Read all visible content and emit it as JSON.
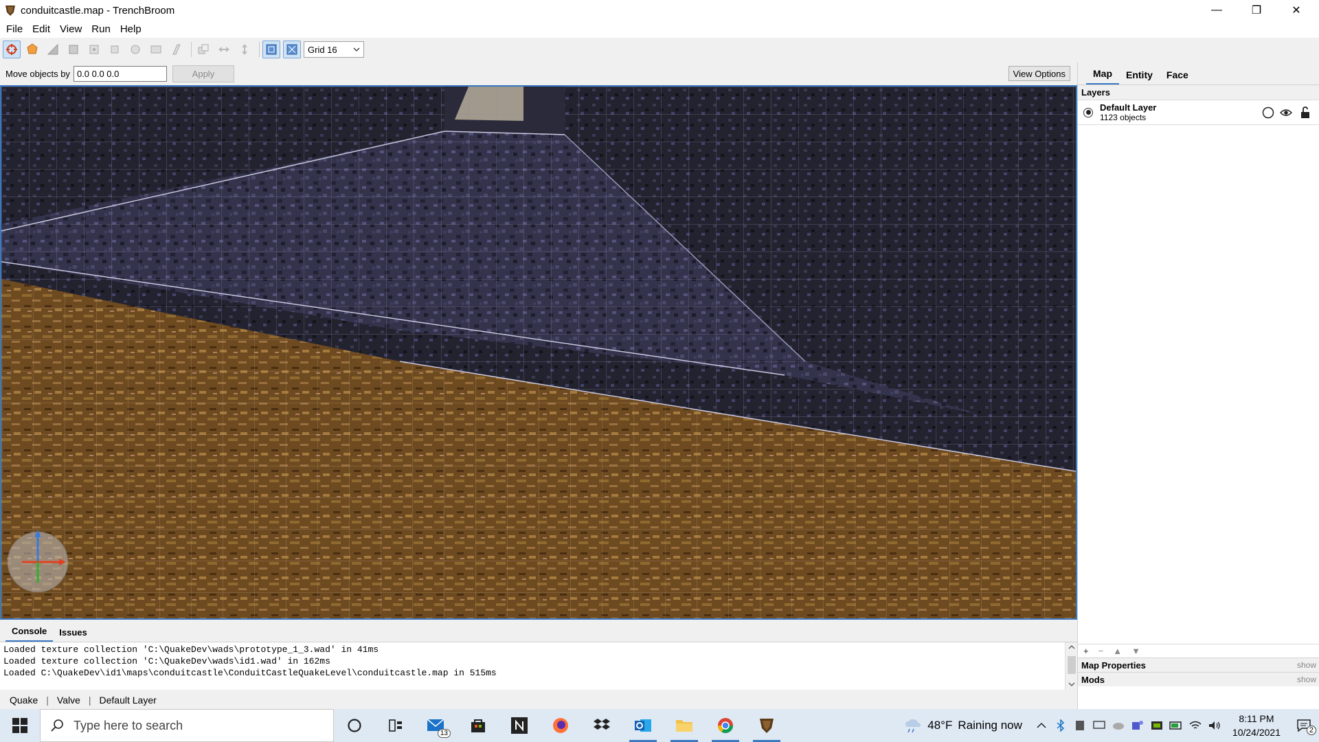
{
  "window": {
    "title": "conduitcastle.map - TrenchBroom",
    "controls": {
      "minimize": "—",
      "maximize": "❐",
      "close": "✕"
    }
  },
  "menu": [
    "File",
    "Edit",
    "View",
    "Run",
    "Help"
  ],
  "toolbar": {
    "tools": [
      "camera-tool-icon",
      "rotate-tool-icon",
      "vertex-tool-icon",
      "edge-tool-icon",
      "face-tool-icon",
      "clip-tool-icon",
      "csg-convex-icon",
      "csg-merge-icon",
      "csg-subtract-icon",
      "csg-intersect-icon",
      "duplicate-icon",
      "flip-horizontal-icon",
      "flip-vertical-icon",
      "texture-lock-icon",
      "uv-lock-icon"
    ],
    "grid_value": "Grid 16"
  },
  "move_row": {
    "label": "Move objects by",
    "value": "0.0 0.0 0.0",
    "apply": "Apply",
    "view_options": "View Options"
  },
  "console": {
    "tabs": [
      "Console",
      "Issues"
    ],
    "lines": [
      "Loaded texture collection 'C:\\QuakeDev\\wads\\prototype_1_3.wad' in 41ms",
      "Loaded texture collection 'C:\\QuakeDev\\wads\\id1.wad' in 162ms",
      "Loaded C:\\QuakeDev\\id1\\maps\\conduitcastle\\ConduitCastleQuakeLevel\\conduitcastle.map in 515ms"
    ]
  },
  "statusbar": {
    "game": "Quake",
    "format": "Valve",
    "layer": "Default Layer"
  },
  "right_panel": {
    "tabs": [
      "Map",
      "Entity",
      "Face"
    ],
    "layers_header": "Layers",
    "layer": {
      "name": "Default Layer",
      "count": "1123 objects"
    },
    "buttons": [
      "+",
      "−",
      "▲",
      "▼"
    ],
    "sections": [
      {
        "label": "Map Properties",
        "action": "show"
      },
      {
        "label": "Mods",
        "action": "show"
      }
    ]
  },
  "taskbar": {
    "search_placeholder": "Type here to search",
    "mail_badge": "13",
    "weather": {
      "temp": "48°F",
      "condition": "Raining now"
    },
    "time": "8:11 PM",
    "date": "10/24/2021",
    "notifications": "2"
  },
  "colors": {
    "accent": "#3a78c2",
    "stone": "#3b3a55",
    "wood": "#6b4a22"
  }
}
